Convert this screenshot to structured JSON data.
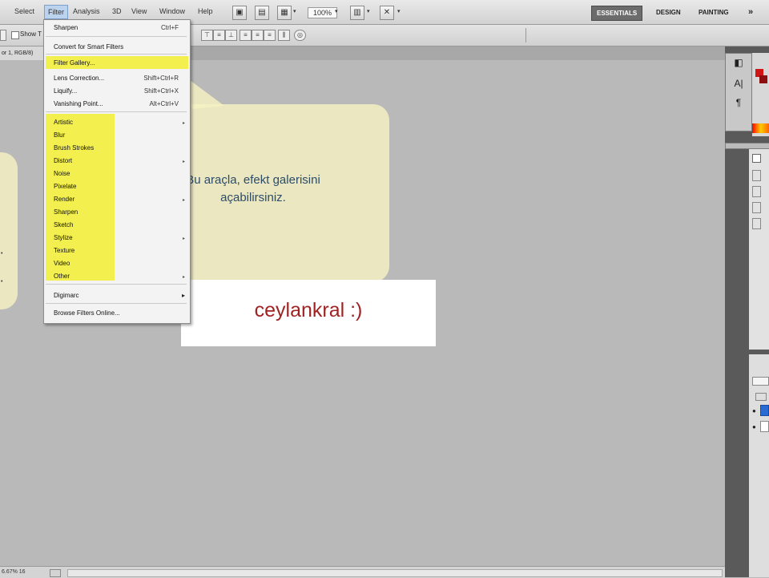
{
  "menubar": {
    "items": [
      "Select",
      "Filter",
      "Analysis",
      "3D",
      "View",
      "Window",
      "Help"
    ],
    "zoom": "100%",
    "workspaces": [
      "ESSENTIALS",
      "DESIGN",
      "PAINTING"
    ],
    "more": "»"
  },
  "options": {
    "show_label": "Show T"
  },
  "document": {
    "tab": "or 1, RGB/8)",
    "status": "6.67% 16"
  },
  "filter_menu": {
    "top_items": [
      {
        "label": "Sharpen",
        "shortcut": "Ctrl+F"
      },
      {
        "label": "Convert for Smart Filters",
        "shortcut": ""
      }
    ],
    "gallery_items": [
      {
        "label": "Filter Gallery...",
        "shortcut": ""
      },
      {
        "label": "Lens Correction...",
        "shortcut": "Shift+Ctrl+R"
      },
      {
        "label": "Liquify...",
        "shortcut": "Shift+Ctrl+X"
      },
      {
        "label": "Vanishing Point...",
        "shortcut": "Alt+Ctrl+V"
      }
    ],
    "categories": [
      "Artistic",
      "Blur",
      "Brush Strokes",
      "Distort",
      "Noise",
      "Pixelate",
      "Render",
      "Sharpen",
      "Sketch",
      "Stylize",
      "Texture",
      "Video",
      "Other"
    ],
    "digimarc": "Digimarc",
    "browse": "Browse Filters Online..."
  },
  "tooltip": {
    "line1": "Bu araçla, efekt galerisini",
    "line2": "açabilirsiniz."
  },
  "watermark": "ceylankral :)",
  "colors": {
    "highlight": "#f3ef4f",
    "balloon": "#f5f2c3",
    "watermark": "#a02323"
  }
}
